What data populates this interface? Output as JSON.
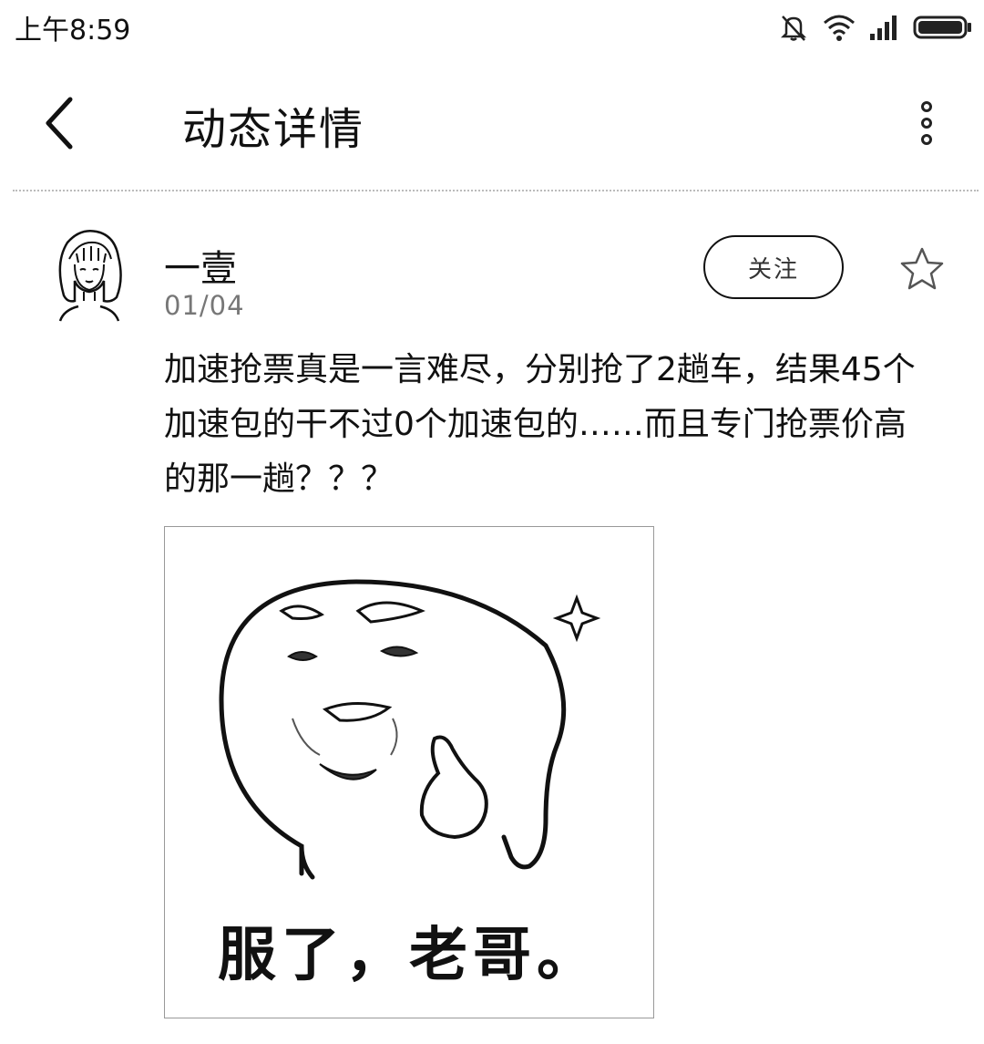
{
  "status_bar": {
    "time": "上午8:59",
    "icons": [
      "mute-icon",
      "wifi-icon",
      "signal-icon",
      "battery-icon"
    ]
  },
  "header": {
    "title": "动态详情",
    "back_icon": "chevron-left-icon",
    "more_icon": "more-vertical-icon"
  },
  "post": {
    "author": "一壹",
    "date": "01/04",
    "follow_label": "关注",
    "favorite_icon": "star-outline-icon",
    "content": "加速抢票真是一言难尽，分别抢了2趟车，结果45个加速包的干不过0个加速包的……而且专门抢票价高的那一趟？？？",
    "image": {
      "caption": "服了，老哥。"
    }
  }
}
